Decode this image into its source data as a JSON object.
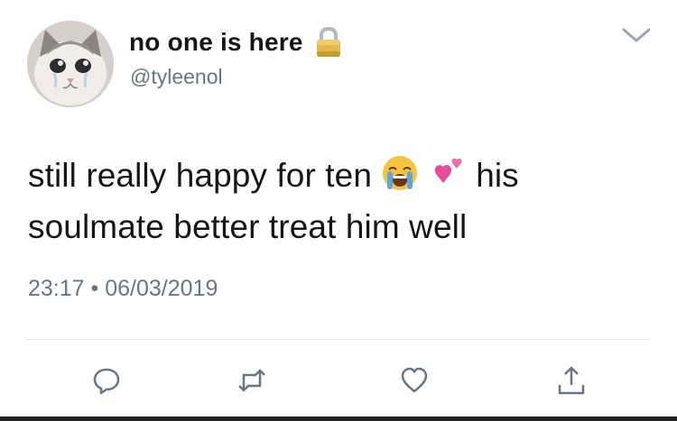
{
  "tweet": {
    "author": {
      "display_name": "no one is here",
      "handle": "@tyleenol",
      "avatar": "crying-cat-avatar",
      "protected_icon": "lock-icon"
    },
    "menu_icon": "chevron-down-icon",
    "text_part1": "still really happy for ten",
    "emojis": [
      "crying-face-emoji",
      "two-hearts-emoji"
    ],
    "text_part2": "his",
    "text_line2": "soulmate better treat him well",
    "time": "23:17",
    "separator": "•",
    "date": "06/03/2019",
    "actions": [
      "reply-icon",
      "retweet-icon",
      "like-icon",
      "share-icon"
    ]
  },
  "colors": {
    "text": "#14171a",
    "secondary": "#657786",
    "divider": "#e1e8ed",
    "lock": "#d9b44a"
  }
}
